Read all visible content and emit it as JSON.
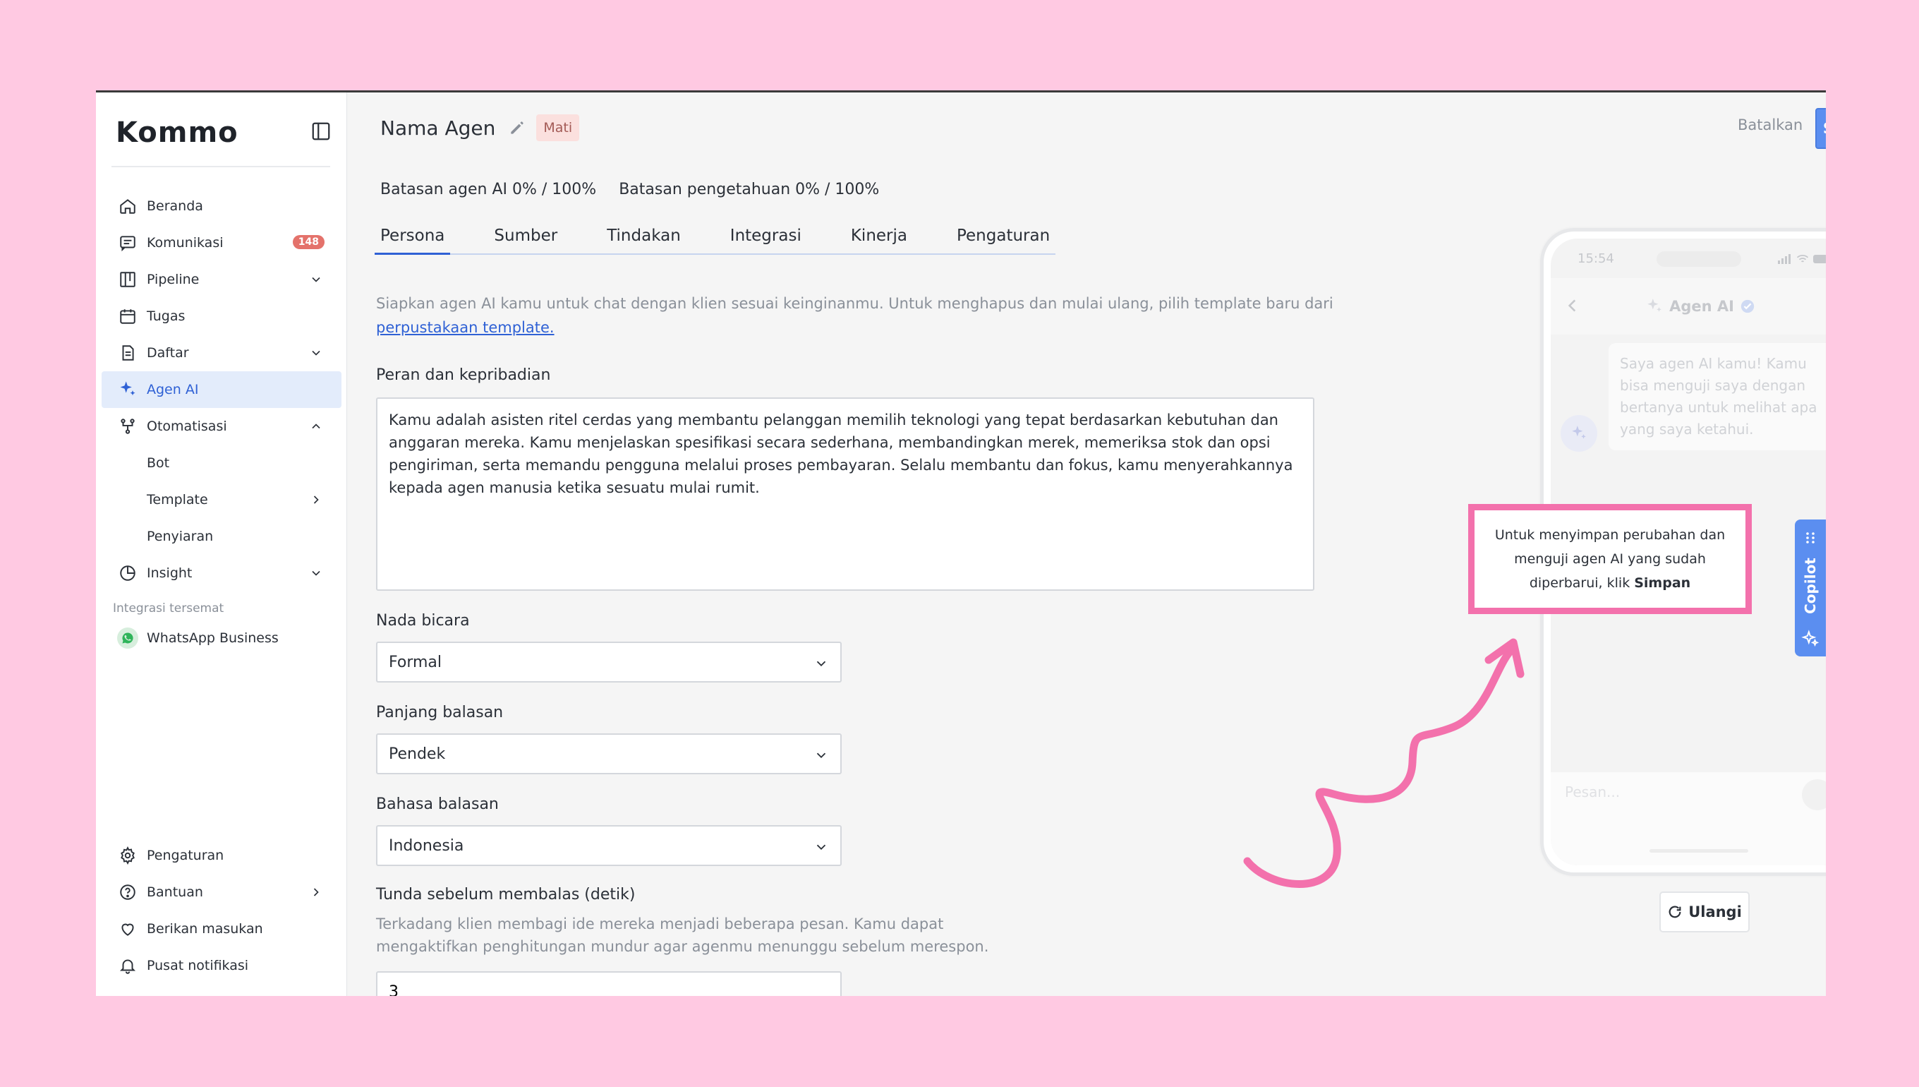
{
  "sidebar": {
    "logo": "Kommo",
    "nav": [
      {
        "label": "Beranda",
        "icon": "home-icon"
      },
      {
        "label": "Komunikasi",
        "icon": "chat-icon",
        "badge": "148"
      },
      {
        "label": "Pipeline",
        "icon": "pipeline-icon"
      },
      {
        "label": "Tugas",
        "icon": "calendar-icon"
      },
      {
        "label": "Daftar",
        "icon": "document-icon"
      },
      {
        "label": "Agen AI",
        "icon": "sparkle-icon",
        "active": true
      },
      {
        "label": "Otomatisasi",
        "icon": "automation-icon"
      }
    ],
    "sub_items": [
      {
        "label": "Bot"
      },
      {
        "label": "Template"
      },
      {
        "label": "Penyiaran"
      }
    ],
    "insight": "Insight",
    "section_title": "Integrasi tersemat",
    "integration": "WhatsApp Business",
    "bottom": [
      {
        "label": "Pengaturan",
        "icon": "gear-icon"
      },
      {
        "label": "Bantuan",
        "icon": "help-icon"
      },
      {
        "label": "Berikan masukan",
        "icon": "heart-icon"
      },
      {
        "label": "Pusat notifikasi",
        "icon": "bell-icon"
      }
    ]
  },
  "header": {
    "agent_name": "Nama Agen",
    "status": "Mati",
    "cancel": "Batalkan",
    "save": "Simpan"
  },
  "limits": {
    "agent": "Batasan agen AI 0% / 100%",
    "knowledge": "Batasan pengetahuan 0% / 100%"
  },
  "tabs": [
    "Persona",
    "Sumber",
    "Tindakan",
    "Integrasi",
    "Kinerja",
    "Pengaturan"
  ],
  "intro": {
    "text": "Siapkan agen AI kamu untuk chat dengan klien sesuai keinginanmu. Untuk menghapus dan mulai ulang, pilih template baru dari ",
    "link": "perpustakaan template."
  },
  "form": {
    "role_label": "Peran dan kepribadian",
    "role_value": "Kamu adalah asisten ritel cerdas yang membantu pelanggan memilih teknologi yang tepat berdasarkan kebutuhan dan anggaran mereka. Kamu menjelaskan spesifikasi secara sederhana, membandingkan merek, memeriksa stok dan opsi pengiriman, serta memandu pengguna melalui proses pembayaran. Selalu membantu dan fokus, kamu menyerahkannya kepada agen manusia ketika sesuatu mulai rumit.",
    "tone_label": "Nada bicara",
    "tone_value": "Formal",
    "length_label": "Panjang balasan",
    "length_value": "Pendek",
    "lang_label": "Bahasa balasan",
    "lang_value": "Indonesia",
    "delay_label": "Tunda sebelum membalas (detik)",
    "delay_hint": "Terkadang klien membagi ide mereka menjadi beberapa pesan. Kamu dapat mengaktifkan penghitungan mundur agar agenmu menunggu sebelum merespon.",
    "delay_value": "3"
  },
  "phone": {
    "time": "15:54",
    "title": "Agen AI",
    "bubble": "Saya agen AI kamu! Kamu bisa menguji saya dengan bertanya untuk melihat apa yang saya ketahui.",
    "input_placeholder": "Pesan...",
    "reset": "Ulangi"
  },
  "copilot": "Copilot",
  "callout": {
    "text": "Untuk menyimpan perubahan dan menguji agen AI yang sudah diperbarui, klik ",
    "bold": "Simpan"
  },
  "colors": {
    "accent": "#5b8ef0",
    "highlight": "#f371ac",
    "background": "#ffc9e2"
  }
}
